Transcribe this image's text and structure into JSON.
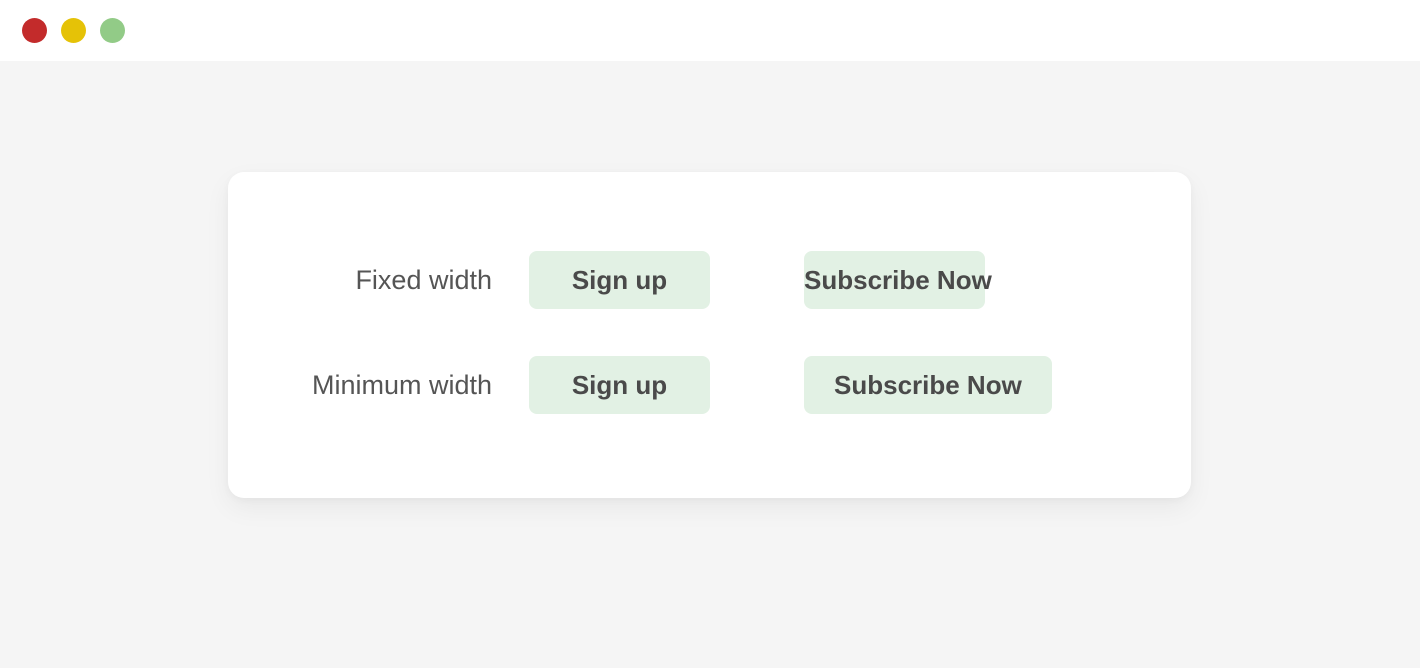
{
  "window": {
    "traffic_lights": [
      {
        "name": "close",
        "color": "#c32b2b"
      },
      {
        "name": "minimize",
        "color": "#e5c207"
      },
      {
        "name": "maximize",
        "color": "#92cb87"
      }
    ]
  },
  "theme": {
    "page_background": "#f5f5f5",
    "card_background": "#ffffff",
    "titlebar_background": "#ffffff",
    "button_background": "#e2f1e4",
    "button_text_color": "#4a4a4a",
    "label_text_color": "#555555"
  },
  "card": {
    "rows": [
      {
        "label": "Fixed width",
        "sizing_mode": "width",
        "buttons": [
          {
            "label": "Sign up",
            "overflows": false
          },
          {
            "label": "Subscribe Now",
            "overflows": true
          }
        ]
      },
      {
        "label": "Minimum width",
        "sizing_mode": "min-width",
        "buttons": [
          {
            "label": "Sign up",
            "overflows": false
          },
          {
            "label": "Subscribe Now",
            "overflows": false
          }
        ]
      }
    ]
  }
}
